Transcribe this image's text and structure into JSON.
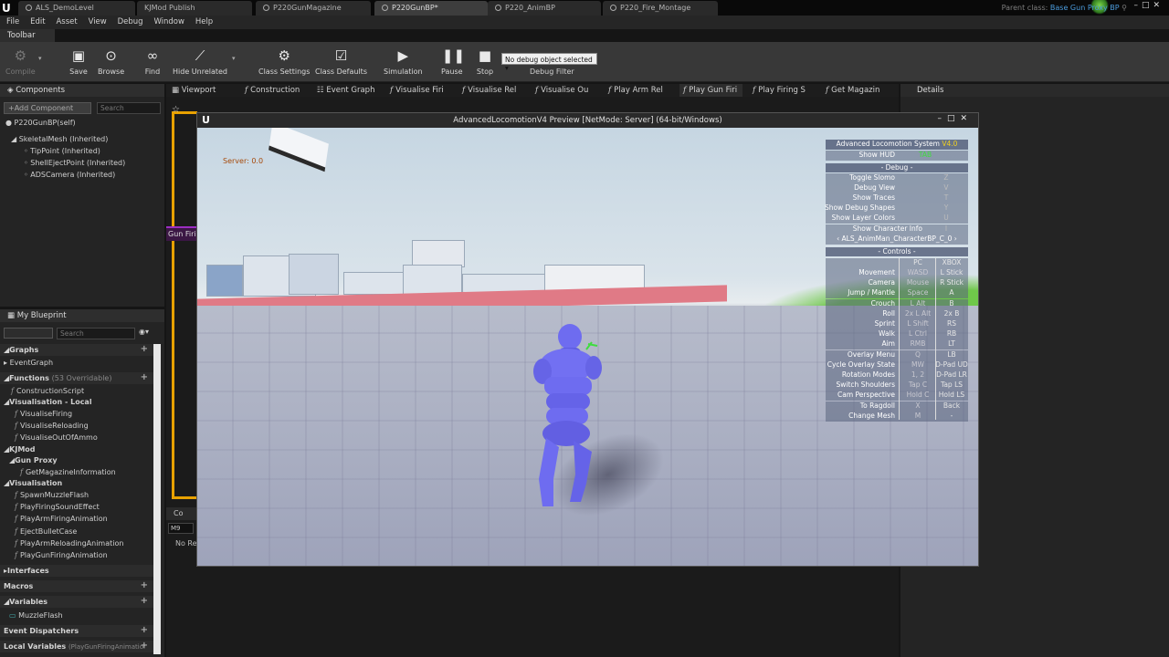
{
  "titlebar": {
    "tabs": [
      {
        "label": "ALS_DemoLevel",
        "active": false
      },
      {
        "label": "KJMod Publish",
        "active": false
      },
      {
        "label": "P220GunMagazine",
        "active": false
      },
      {
        "label": "P220GunBP*",
        "active": true
      },
      {
        "label": "P220_AnimBP",
        "active": false
      },
      {
        "label": "P220_Fire_Montage",
        "active": false
      }
    ],
    "parent_class_label": "Parent class:",
    "parent_class_value": "Base Gun Proxy BP"
  },
  "menu": [
    "File",
    "Edit",
    "Asset",
    "View",
    "Debug",
    "Window",
    "Help"
  ],
  "toolbar": {
    "tab_label": "Toolbar",
    "buttons": {
      "compile": "Compile",
      "save": "Save",
      "browse": "Browse",
      "find": "Find",
      "hide_unrelated": "Hide Unrelated",
      "class_settings": "Class Settings",
      "class_defaults": "Class Defaults",
      "simulation": "Simulation",
      "pause": "Pause",
      "stop": "Stop"
    },
    "debug_select": "No debug object selected",
    "debug_filter": "Debug Filter"
  },
  "components": {
    "header": "Components",
    "add_button": "+Add Component",
    "search_placeholder": "Search",
    "self": "P220GunBP(self)",
    "items": [
      "SkeletalMesh (Inherited)",
      "TipPoint (Inherited)",
      "ShellEjectPoint (Inherited)",
      "ADSCamera (Inherited)"
    ]
  },
  "my_blueprint": {
    "header": "My Blueprint",
    "search_placeholder": "Search",
    "graphs_label": "Graphs",
    "event_graph": "EventGraph",
    "functions_label": "Functions",
    "functions_count": "(53 Overridable)",
    "construction_script": "ConstructionScript",
    "vis_local_label": "Visualisation - Local",
    "vis_local_items": [
      "VisualiseFiring",
      "VisualiseReloading",
      "VisualiseOutOfAmmo"
    ],
    "kjmod_label": "KJMod",
    "gun_proxy_label": "Gun Proxy",
    "gun_proxy_items": [
      "GetMagazineInformation"
    ],
    "visualisation_label": "Visualisation",
    "visualisation_items": [
      "SpawnMuzzleFlash",
      "PlayFiringSoundEffect",
      "PlayArmFiringAnimation",
      "EjectBulletCase",
      "PlayArmReloadingAnimation",
      "PlayGunFiringAnimation"
    ],
    "interfaces_label": "Interfaces",
    "macros_label": "Macros",
    "variables_label": "Variables",
    "variables_items": [
      "MuzzleFlash"
    ],
    "event_dispatchers_label": "Event Dispatchers",
    "local_variables_label": "Local Variables",
    "local_variables_scope": "(PlayGunFiringAnimatior"
  },
  "graph_tabs": [
    "Viewport",
    "Construction",
    "Event Graph",
    "Visualise Firi",
    "Visualise Rel",
    "Visualise Ou",
    "Play Arm Rel",
    "Play Gun Firi",
    "Play Firing S",
    "Get Magazin"
  ],
  "details": {
    "header": "Details"
  },
  "graph": {
    "node_label": "Gun Firi",
    "compiler_tab": "Co",
    "compiler_m9": "M9",
    "compiler_text": "No Re"
  },
  "preview": {
    "title": "AdvancedLocomotionV4 Preview [NetMode: Server] (64-bit/Windows)",
    "server_label": "Server: 0.0",
    "hud": {
      "title": "Advanced Locomotion System",
      "version": "V4.0",
      "show_hud_label": "Show HUD",
      "show_hud_key": "TAB",
      "debug_header": "- Debug -",
      "debug_rows": [
        {
          "label": "Toggle Slomo",
          "key": "Z"
        },
        {
          "label": "Debug View",
          "key": "V"
        },
        {
          "label": "Show Traces",
          "key": "T"
        },
        {
          "label": "Show Debug Shapes",
          "key": "Y"
        },
        {
          "label": "Show Layer Colors",
          "key": "U"
        },
        {
          "label": "Show Character Info",
          "key": "I"
        }
      ],
      "character_select": "‹  ALS_AnimMan_CharacterBP_C_0  ›",
      "controls_header": "- Controls -",
      "col_pc": "PC",
      "col_xbox": "XBOX",
      "control_rows": [
        {
          "label": "Movement",
          "pc": "WASD",
          "xbox": "L Stick"
        },
        {
          "label": "Camera",
          "pc": "Mouse",
          "xbox": "R Stick"
        },
        {
          "label": "Jump / Mantle",
          "pc": "Space",
          "xbox": "A"
        },
        {
          "label": "Crouch",
          "pc": "L Alt",
          "xbox": "B"
        },
        {
          "label": "Roll",
          "pc": "2x L Alt",
          "xbox": "2x B"
        },
        {
          "label": "Sprint",
          "pc": "L Shift",
          "xbox": "RS"
        },
        {
          "label": "Walk",
          "pc": "L Ctrl",
          "xbox": "RB"
        },
        {
          "label": "Aim",
          "pc": "RMB",
          "xbox": "LT"
        },
        {
          "label": "Overlay Menu",
          "pc": "Q",
          "xbox": "LB"
        },
        {
          "label": "Cycle Overlay State",
          "pc": "MW",
          "xbox": "D-Pad UD"
        },
        {
          "label": "Rotation Modes",
          "pc": "1, 2",
          "xbox": "D-Pad LR"
        },
        {
          "label": "Switch Shoulders",
          "pc": "Tap C",
          "xbox": "Tap LS"
        },
        {
          "label": "Cam Perspective",
          "pc": "Hold C",
          "xbox": "Hold LS"
        },
        {
          "label": "To Ragdoll",
          "pc": "X",
          "xbox": "Back"
        },
        {
          "label": "Change Mesh",
          "pc": "M",
          "xbox": "-"
        }
      ]
    }
  },
  "colors": {
    "accent_orange": "#e8a100",
    "link_blue": "#4b9bdc",
    "hud_green": "#3fdc3f",
    "mannequin": "#6e6cf0"
  }
}
